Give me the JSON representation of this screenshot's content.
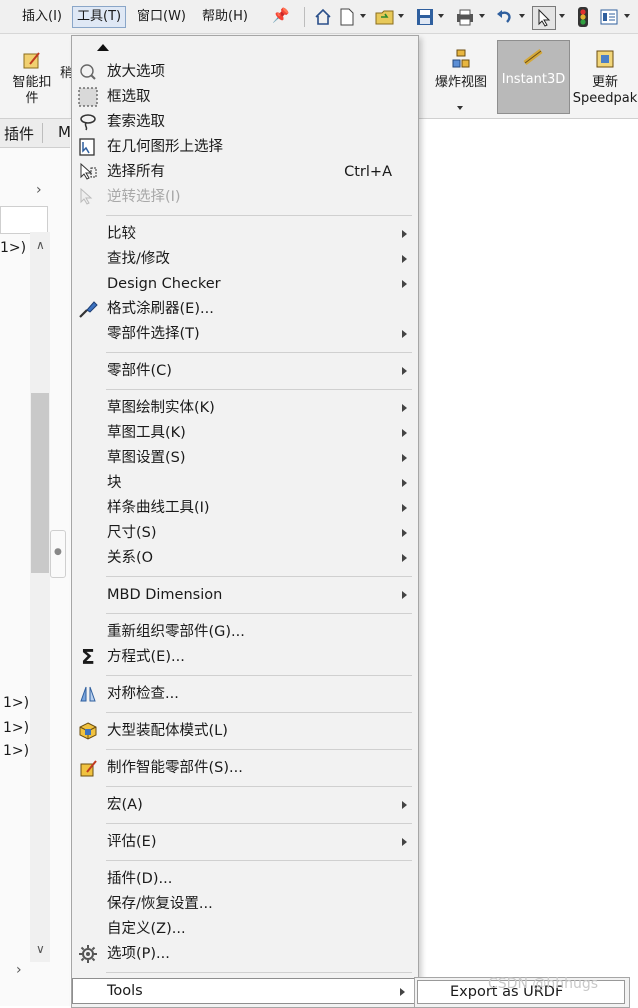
{
  "menubar": {
    "items": [
      {
        "label": "插入(I)"
      },
      {
        "label": "工具(T)"
      },
      {
        "label": "窗口(W)"
      },
      {
        "label": "帮助(H)"
      }
    ]
  },
  "ribbon": {
    "smart_fastener": "智能扣件",
    "partial_label": "稍",
    "exploded_view": "爆炸视图",
    "instant3d": "Instant3D",
    "update_speedpak": "更新\nSpeedpak"
  },
  "left_panel": {
    "tab_plugins": "插件",
    "tab_m": "M",
    "row_labels": [
      "1>)",
      "1>)",
      "1>)",
      "1>)"
    ]
  },
  "dropdown": {
    "items": [
      {
        "label": "放大选项",
        "icon": "zoom-icon"
      },
      {
        "label": "框选取",
        "icon": "box-select-icon"
      },
      {
        "label": "套索选取",
        "icon": "lasso-icon"
      },
      {
        "label": "在几何图形上选择",
        "icon": "geometry-select-icon"
      },
      {
        "label": "选择所有",
        "shortcut": "Ctrl+A",
        "icon": "select-all-icon"
      },
      {
        "label": "逆转选择(I)",
        "disabled": true,
        "icon": "invert-select-icon"
      },
      {
        "label": "比较"
      },
      {
        "label": "查找/修改"
      },
      {
        "label": "Design Checker"
      },
      {
        "label": "格式涂刷器(E)...",
        "icon": "format-painter-icon"
      },
      {
        "label": "零部件选择(T)"
      },
      {
        "label": "零部件(C)"
      },
      {
        "label": "草图绘制实体(K)"
      },
      {
        "label": "草图工具(K)"
      },
      {
        "label": "草图设置(S)"
      },
      {
        "label": "块"
      },
      {
        "label": "样条曲线工具(I)"
      },
      {
        "label": "尺寸(S)"
      },
      {
        "label": "关系(O"
      },
      {
        "label": "MBD Dimension"
      },
      {
        "label": "重新组织零部件(G)..."
      },
      {
        "label": "方程式(E)...",
        "icon": "sigma-icon"
      },
      {
        "label": "对称检查...",
        "icon": "symmetry-icon"
      },
      {
        "label": "大型装配体模式(L)",
        "icon": "large-assembly-icon"
      },
      {
        "label": "制作智能零部件(S)...",
        "icon": "smart-component-icon"
      },
      {
        "label": "宏(A)"
      },
      {
        "label": "评估(E)"
      },
      {
        "label": "插件(D)..."
      },
      {
        "label": "保存/恢复设置..."
      },
      {
        "label": "自定义(Z)..."
      },
      {
        "label": "选项(P)...",
        "icon": "gear-icon"
      },
      {
        "label": "Tools"
      }
    ]
  },
  "submenu": {
    "export_urdf": "Export as URDF"
  },
  "watermark": "CSDN @hhhugs",
  "colors": {
    "menu_bg": "#f2f2f2",
    "instant3d_bg": "#b9b9b9",
    "pin_blue": "#2a6bc8"
  }
}
